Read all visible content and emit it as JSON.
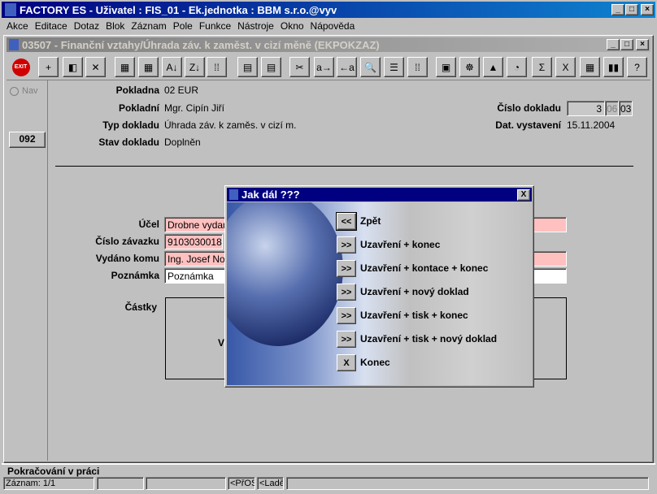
{
  "app": {
    "title": "FACTORY ES - Uživatel : FIS_01 - Ek.jednotka : BBM s.r.o.@vyv"
  },
  "menu": [
    "Akce",
    "Editace",
    "Dotaz",
    "Blok",
    "Záznam",
    "Pole",
    "Funkce",
    "Nástroje",
    "Okno",
    "Nápověda"
  ],
  "child": {
    "title": "03507 - Finanční vztahy/Úhrada záv. k zaměst. v cizí měně (EKPOKZAZ)"
  },
  "toolbar": [
    {
      "icon": "exit-icon",
      "glyph": "EXIT"
    },
    {
      "icon": "add-record-icon",
      "glyph": "+"
    },
    {
      "icon": "save-icon",
      "glyph": "◧"
    },
    {
      "icon": "delete-record-icon",
      "glyph": "✕"
    },
    {
      "icon": "query-icon",
      "glyph": "▦"
    },
    {
      "icon": "execute-query-icon",
      "glyph": "▦"
    },
    {
      "icon": "sort-asc-icon",
      "glyph": "A↓"
    },
    {
      "icon": "sort-desc-icon",
      "glyph": "Z↓"
    },
    {
      "icon": "sort-multi-icon",
      "glyph": "⁞⁞"
    },
    {
      "icon": "print-icon",
      "glyph": "▤"
    },
    {
      "icon": "print-preview-icon",
      "glyph": "▤"
    },
    {
      "icon": "cut-icon",
      "glyph": "✂"
    },
    {
      "icon": "copy-icon",
      "glyph": "a→"
    },
    {
      "icon": "paste-icon",
      "glyph": "←a"
    },
    {
      "icon": "find-icon",
      "glyph": "🔍"
    },
    {
      "icon": "list-icon",
      "glyph": "☰"
    },
    {
      "icon": "columns-icon",
      "glyph": "⁞⁞"
    },
    {
      "icon": "form-icon",
      "glyph": "▣"
    },
    {
      "icon": "wheel-icon",
      "glyph": "☸"
    },
    {
      "icon": "triangle-icon",
      "glyph": "▲"
    },
    {
      "icon": "clock-icon",
      "glyph": "◔"
    },
    {
      "icon": "sum-icon",
      "glyph": "Σ"
    },
    {
      "icon": "excel-icon",
      "glyph": "X"
    },
    {
      "icon": "calculator-icon",
      "glyph": "▦"
    },
    {
      "icon": "window-icon",
      "glyph": "▮▮"
    },
    {
      "icon": "help-icon",
      "glyph": "?"
    }
  ],
  "left": {
    "nav_label": "Nav",
    "code_button": "092"
  },
  "header": {
    "pokladna_label": "Pokladna",
    "pokladna_value": "02 EUR",
    "pokladni_label": "Pokladní",
    "pokladni_value": "Mgr. Cipín Jiří",
    "typ_label": "Typ dokladu",
    "typ_value": "Úhrada záv. k zaměs. v cizí m.",
    "stav_label": "Stav dokladu",
    "stav_value": "Doplněn",
    "cislo_label": "Číslo dokladu",
    "cislo_parts": [
      "3",
      "06",
      "03"
    ],
    "datum_label": "Dat. vystavení",
    "datum_value": "15.11.2004"
  },
  "form": {
    "ucel_label": "Účel",
    "ucel_value": "Drobne vydani",
    "zavazek_label": "Číslo závazku",
    "zavazek_value": "9103030018",
    "komu_label": "Vydáno komu",
    "komu_value": "Ing. Josef Nov",
    "poznamka_label": "Poznámka",
    "poznamka_value": "Poznámka",
    "castky_label": "Částky",
    "castky_partial": "V"
  },
  "dialog": {
    "title": "Jak dál ???",
    "close": "X",
    "options": [
      {
        "btn": "<<",
        "label": "Zpět"
      },
      {
        "btn": ">>",
        "label": "Uzavření + konec"
      },
      {
        "btn": ">>",
        "label": "Uzavření + kontace + konec"
      },
      {
        "btn": ">>",
        "label": "Uzavření + nový doklad"
      },
      {
        "btn": ">>",
        "label": "Uzavření + tisk + konec"
      },
      {
        "btn": ">>",
        "label": "Uzavření + tisk + nový doklad"
      },
      {
        "btn": "X",
        "label": "Konec"
      }
    ]
  },
  "status": {
    "message": "Pokračování v práci",
    "cells": [
      "Záznam: 1/1",
      "",
      "",
      "<PřOS",
      "<Ladě",
      ""
    ]
  }
}
